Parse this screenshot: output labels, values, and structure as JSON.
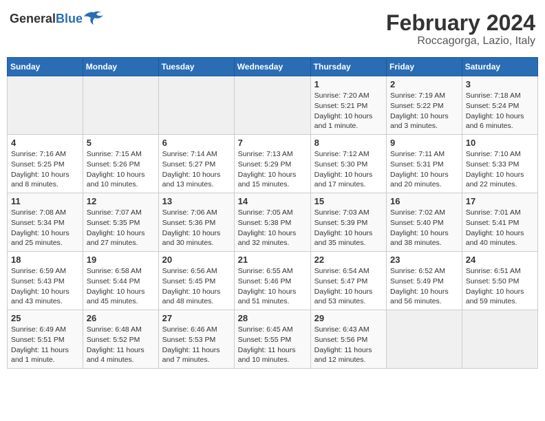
{
  "logo": {
    "general": "General",
    "blue": "Blue"
  },
  "title": {
    "month_year": "February 2024",
    "location": "Roccagorga, Lazio, Italy"
  },
  "weekdays": [
    "Sunday",
    "Monday",
    "Tuesday",
    "Wednesday",
    "Thursday",
    "Friday",
    "Saturday"
  ],
  "weeks": [
    [
      {
        "day": "",
        "info": ""
      },
      {
        "day": "",
        "info": ""
      },
      {
        "day": "",
        "info": ""
      },
      {
        "day": "",
        "info": ""
      },
      {
        "day": "1",
        "info": "Sunrise: 7:20 AM\nSunset: 5:21 PM\nDaylight: 10 hours\nand 1 minute."
      },
      {
        "day": "2",
        "info": "Sunrise: 7:19 AM\nSunset: 5:22 PM\nDaylight: 10 hours\nand 3 minutes."
      },
      {
        "day": "3",
        "info": "Sunrise: 7:18 AM\nSunset: 5:24 PM\nDaylight: 10 hours\nand 6 minutes."
      }
    ],
    [
      {
        "day": "4",
        "info": "Sunrise: 7:16 AM\nSunset: 5:25 PM\nDaylight: 10 hours\nand 8 minutes."
      },
      {
        "day": "5",
        "info": "Sunrise: 7:15 AM\nSunset: 5:26 PM\nDaylight: 10 hours\nand 10 minutes."
      },
      {
        "day": "6",
        "info": "Sunrise: 7:14 AM\nSunset: 5:27 PM\nDaylight: 10 hours\nand 13 minutes."
      },
      {
        "day": "7",
        "info": "Sunrise: 7:13 AM\nSunset: 5:29 PM\nDaylight: 10 hours\nand 15 minutes."
      },
      {
        "day": "8",
        "info": "Sunrise: 7:12 AM\nSunset: 5:30 PM\nDaylight: 10 hours\nand 17 minutes."
      },
      {
        "day": "9",
        "info": "Sunrise: 7:11 AM\nSunset: 5:31 PM\nDaylight: 10 hours\nand 20 minutes."
      },
      {
        "day": "10",
        "info": "Sunrise: 7:10 AM\nSunset: 5:33 PM\nDaylight: 10 hours\nand 22 minutes."
      }
    ],
    [
      {
        "day": "11",
        "info": "Sunrise: 7:08 AM\nSunset: 5:34 PM\nDaylight: 10 hours\nand 25 minutes."
      },
      {
        "day": "12",
        "info": "Sunrise: 7:07 AM\nSunset: 5:35 PM\nDaylight: 10 hours\nand 27 minutes."
      },
      {
        "day": "13",
        "info": "Sunrise: 7:06 AM\nSunset: 5:36 PM\nDaylight: 10 hours\nand 30 minutes."
      },
      {
        "day": "14",
        "info": "Sunrise: 7:05 AM\nSunset: 5:38 PM\nDaylight: 10 hours\nand 32 minutes."
      },
      {
        "day": "15",
        "info": "Sunrise: 7:03 AM\nSunset: 5:39 PM\nDaylight: 10 hours\nand 35 minutes."
      },
      {
        "day": "16",
        "info": "Sunrise: 7:02 AM\nSunset: 5:40 PM\nDaylight: 10 hours\nand 38 minutes."
      },
      {
        "day": "17",
        "info": "Sunrise: 7:01 AM\nSunset: 5:41 PM\nDaylight: 10 hours\nand 40 minutes."
      }
    ],
    [
      {
        "day": "18",
        "info": "Sunrise: 6:59 AM\nSunset: 5:43 PM\nDaylight: 10 hours\nand 43 minutes."
      },
      {
        "day": "19",
        "info": "Sunrise: 6:58 AM\nSunset: 5:44 PM\nDaylight: 10 hours\nand 45 minutes."
      },
      {
        "day": "20",
        "info": "Sunrise: 6:56 AM\nSunset: 5:45 PM\nDaylight: 10 hours\nand 48 minutes."
      },
      {
        "day": "21",
        "info": "Sunrise: 6:55 AM\nSunset: 5:46 PM\nDaylight: 10 hours\nand 51 minutes."
      },
      {
        "day": "22",
        "info": "Sunrise: 6:54 AM\nSunset: 5:47 PM\nDaylight: 10 hours\nand 53 minutes."
      },
      {
        "day": "23",
        "info": "Sunrise: 6:52 AM\nSunset: 5:49 PM\nDaylight: 10 hours\nand 56 minutes."
      },
      {
        "day": "24",
        "info": "Sunrise: 6:51 AM\nSunset: 5:50 PM\nDaylight: 10 hours\nand 59 minutes."
      }
    ],
    [
      {
        "day": "25",
        "info": "Sunrise: 6:49 AM\nSunset: 5:51 PM\nDaylight: 11 hours\nand 1 minute."
      },
      {
        "day": "26",
        "info": "Sunrise: 6:48 AM\nSunset: 5:52 PM\nDaylight: 11 hours\nand 4 minutes."
      },
      {
        "day": "27",
        "info": "Sunrise: 6:46 AM\nSunset: 5:53 PM\nDaylight: 11 hours\nand 7 minutes."
      },
      {
        "day": "28",
        "info": "Sunrise: 6:45 AM\nSunset: 5:55 PM\nDaylight: 11 hours\nand 10 minutes."
      },
      {
        "day": "29",
        "info": "Sunrise: 6:43 AM\nSunset: 5:56 PM\nDaylight: 11 hours\nand 12 minutes."
      },
      {
        "day": "",
        "info": ""
      },
      {
        "day": "",
        "info": ""
      }
    ]
  ]
}
